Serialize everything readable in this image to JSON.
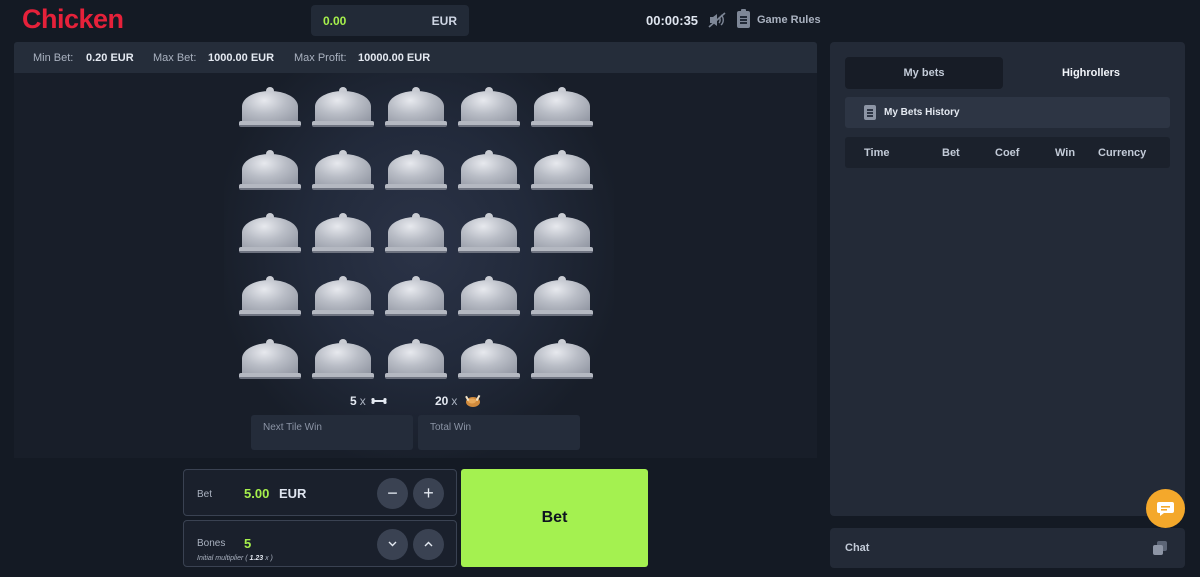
{
  "header": {
    "logo": "Chicken",
    "balance": "0.00",
    "currency": "EUR",
    "timer": "00:00:35",
    "rules_label": "Game Rules",
    "icons": [
      "sound-muted-icon",
      "rules-clipboard-icon"
    ]
  },
  "limits": {
    "min_label": "Min Bet:",
    "min_value": "0.20 EUR",
    "max_label": "Max Bet:",
    "max_value": "1000.00 EUR",
    "profit_label": "Max Profit:",
    "profit_value": "10000.00 EUR"
  },
  "board": {
    "rows": 5,
    "cols": 5,
    "bones_count": "5",
    "chickens_count": "20",
    "times": "x",
    "next_tile_win": "Next Tile Win",
    "total_win": "Total Win"
  },
  "controls": {
    "bet_label": "Bet",
    "bet_value": "5.00",
    "bet_currency": "EUR",
    "minus": "−",
    "plus": "+",
    "bones_label": "Bones",
    "bones_value": "5",
    "multiplier_prefix": "Initial multiplier (",
    "multiplier_value": "1.23",
    "multiplier_suffix": "x )",
    "down": "⌄",
    "up": "⌃",
    "bet_button": "Bet"
  },
  "panel": {
    "tab_my_bets": "My bets",
    "tab_highrollers": "Highrollers",
    "history_title": "My Bets History",
    "columns": [
      "Time",
      "Bet",
      "Coef",
      "Win",
      "Currency"
    ],
    "chat_label": "Chat"
  },
  "colors": {
    "accent_green": "#a4f150",
    "logo_red": "#e6213a",
    "support_orange": "#f4a82b"
  }
}
